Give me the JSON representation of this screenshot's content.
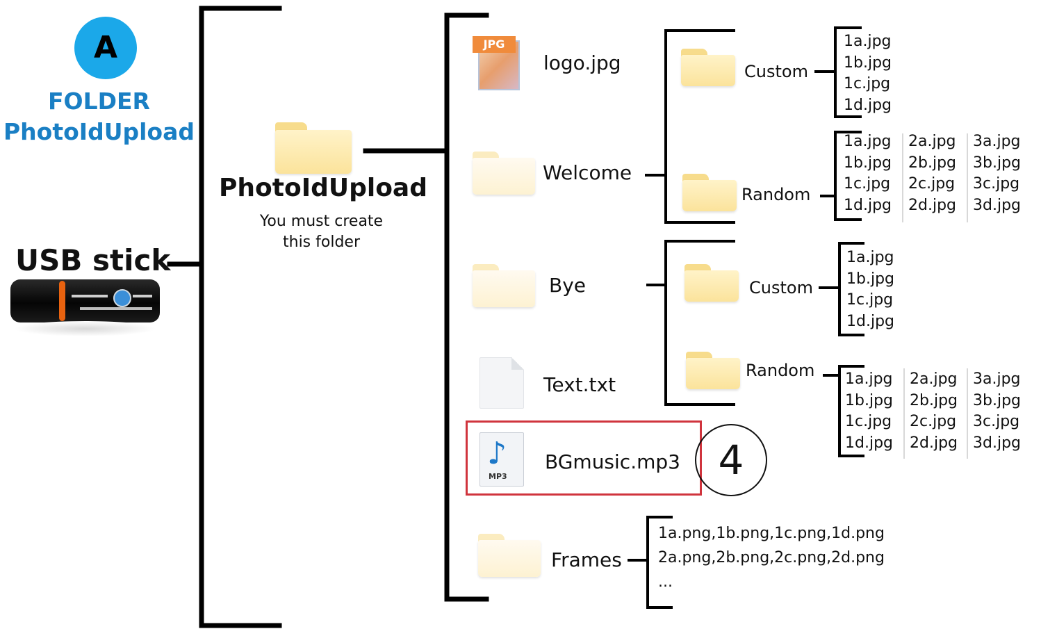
{
  "badge": {
    "letter": "A",
    "color": "#1ba8e9"
  },
  "heading": {
    "line1": "FOLDER",
    "line2": "PhotoIdUpload",
    "color": "#1a7fc4"
  },
  "usb": {
    "title": "USB stick"
  },
  "root_folder": {
    "name": "PhotoIdUpload",
    "note_line1": "You must create",
    "note_line2": "this folder"
  },
  "items": {
    "logo": {
      "name": "logo.jpg",
      "icon": "jpg-file-icon",
      "icon_label": "JPG"
    },
    "welcome": {
      "name": "Welcome",
      "icon": "folder-icon"
    },
    "bye": {
      "name": "Bye",
      "icon": "folder-icon"
    },
    "text": {
      "name": "Text.txt",
      "icon": "text-file-icon"
    },
    "bgmusic": {
      "name": "BGmusic.mp3",
      "icon": "mp3-file-icon",
      "icon_label": "MP3",
      "highlight_color": "#d0343d"
    },
    "frames": {
      "name": "Frames",
      "icon": "folder-icon"
    }
  },
  "welcome": {
    "custom": {
      "label": "Custom",
      "files": [
        "1a.jpg",
        "1b.jpg",
        "1c.jpg",
        "1d.jpg"
      ]
    },
    "random": {
      "label": "Random",
      "columns": [
        [
          "1a.jpg",
          "1b.jpg",
          "1c.jpg",
          "1d.jpg"
        ],
        [
          "2a.jpg",
          "2b.jpg",
          "2c.jpg",
          "2d.jpg"
        ],
        [
          "3a.jpg",
          "3b.jpg",
          "3c.jpg",
          "3d.jpg"
        ]
      ]
    }
  },
  "bye": {
    "custom": {
      "label": "Custom",
      "files": [
        "1a.jpg",
        "1b.jpg",
        "1c.jpg",
        "1d.jpg"
      ]
    },
    "random": {
      "label": "Random",
      "columns": [
        [
          "1a.jpg",
          "1b.jpg",
          "1c.jpg",
          "1d.jpg"
        ],
        [
          "2a.jpg",
          "2b.jpg",
          "2c.jpg",
          "2d.jpg"
        ],
        [
          "3a.jpg",
          "3b.jpg",
          "3c.jpg",
          "3d.jpg"
        ]
      ]
    }
  },
  "frames": {
    "lines": [
      "1a.png,1b.png,1c.png,1d.png",
      "2a.png,2b.png,2c.png,2d.png",
      "..."
    ]
  },
  "step": {
    "number": "4"
  }
}
